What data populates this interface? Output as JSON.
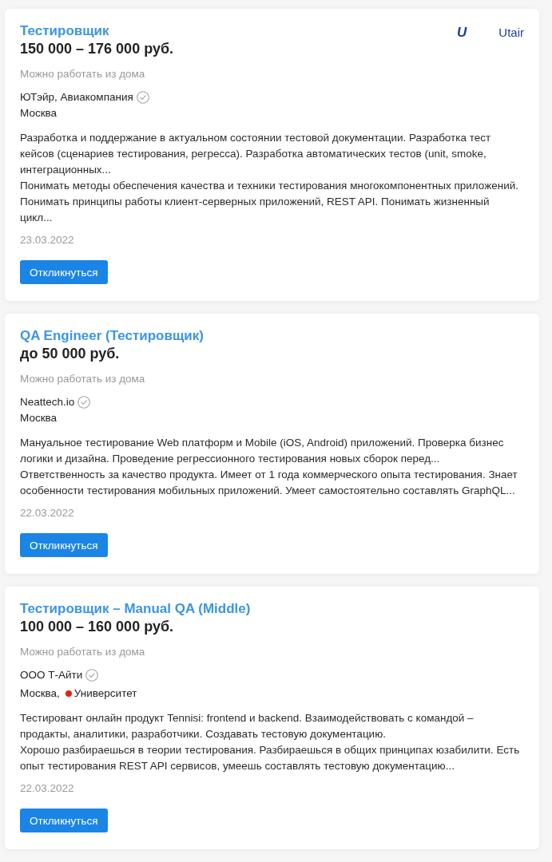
{
  "vacancies": [
    {
      "title": "Тестировщик",
      "salary": "150 000 – 176 000 руб.",
      "employer_logo": {
        "mark": "U",
        "name": "Utair"
      },
      "remote": "Можно работать из дома",
      "company": "ЮТэйр, Авиакомпания",
      "company_verified": true,
      "location": {
        "city": "Москва"
      },
      "description": [
        "Разработка и поддержание в актуальном состоянии тестовой документации. Разработка тест кейсов (сценариев тестирования, регресса). Разработка автоматических тестов (unit, smoke, интеграционных...",
        "Понимать методы обеспечения качества и техники тестирования многокомпонентных приложений. Понимать принципы работы клиент-серверных приложений, REST API. Понимать жизненный цикл..."
      ],
      "date": "23.03.2022",
      "button": "Откликнуться"
    },
    {
      "title": "QA Engineer (Тестировщик)",
      "salary": "до 50 000 руб.",
      "remote": "Можно работать из дома",
      "company": "Neattech.io",
      "company_verified": true,
      "location": {
        "city": "Москва"
      },
      "description": [
        "Мануальное тестирование Web платформ и Mobile (iOS, Android) приложений. Проверка бизнес логики и дизайна. Проведение регрессионного тестирования новых сборок перед...",
        "Ответственность за качество продукта. Имеет от 1 года коммерческого опыта тестирования. Знает особенности тестирования мобильных приложений. Умеет самостоятельно составлять GraphQL..."
      ],
      "date": "22.03.2022",
      "button": "Откликнуться"
    },
    {
      "title": "Тестировщик – Manual QA (Middle)",
      "salary": "100 000 – 160 000 руб.",
      "remote": "Можно работать из дома",
      "company": "ООО Т-Айти",
      "company_verified": true,
      "location": {
        "city": "Москва,",
        "metro": {
          "station": "Университет",
          "color": "#e42313"
        }
      },
      "description": [
        "Тестировант онлайн продукт Tennisi: frontend и backend. Взаимодействовать с командой – продакты, аналитики, разработчики. Создавать тестовую документацию.",
        "Хорошо разбираешься в теории тестирования. Разбираешься в общих принципах юзабилити. Есть опыт тестирования REST API сервисов, умеешь составлять тестовую документацию..."
      ],
      "date": "22.03.2022",
      "button": "Откликнуться"
    }
  ]
}
